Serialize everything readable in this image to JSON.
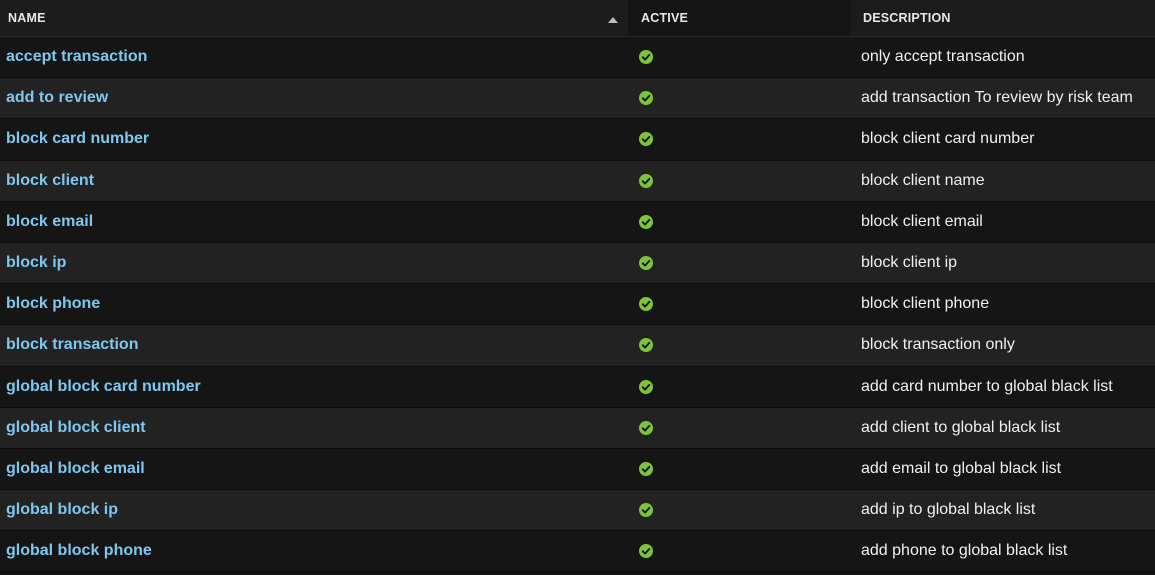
{
  "columns": {
    "name": "NAME",
    "active": "ACTIVE",
    "description": "DESCRIPTION",
    "sort": {
      "column": "name",
      "direction": "ascending"
    }
  },
  "colors": {
    "name_link": "#7ec8f0",
    "active_check": "#7dc43a",
    "row_odd": "#151515",
    "row_even": "#222222"
  },
  "rows": [
    {
      "name": "accept transaction",
      "active": true,
      "active_icon": "check-circle-icon",
      "description": "only accept transaction"
    },
    {
      "name": "add to review",
      "active": true,
      "active_icon": "check-circle-icon",
      "description": "add transaction To review by risk team"
    },
    {
      "name": "block card number",
      "active": true,
      "active_icon": "check-circle-icon",
      "description": "block client card number"
    },
    {
      "name": "block client",
      "active": true,
      "active_icon": "check-circle-icon",
      "description": "block client name"
    },
    {
      "name": "block email",
      "active": true,
      "active_icon": "check-circle-icon",
      "description": "block client email"
    },
    {
      "name": "block ip",
      "active": true,
      "active_icon": "check-circle-icon",
      "description": "block client ip"
    },
    {
      "name": "block phone",
      "active": true,
      "active_icon": "check-circle-icon",
      "description": "block client phone"
    },
    {
      "name": "block transaction",
      "active": true,
      "active_icon": "check-circle-icon",
      "description": "block transaction only"
    },
    {
      "name": "global block card number",
      "active": true,
      "active_icon": "check-circle-icon",
      "description": "add card number to global black list"
    },
    {
      "name": "global block client",
      "active": true,
      "active_icon": "check-circle-icon",
      "description": "add client to global black list"
    },
    {
      "name": "global block email",
      "active": true,
      "active_icon": "check-circle-icon",
      "description": "add email to global black list"
    },
    {
      "name": "global block ip",
      "active": true,
      "active_icon": "check-circle-icon",
      "description": "add ip to global black list"
    },
    {
      "name": "global block phone",
      "active": true,
      "active_icon": "check-circle-icon",
      "description": "add phone to global black list"
    }
  ]
}
